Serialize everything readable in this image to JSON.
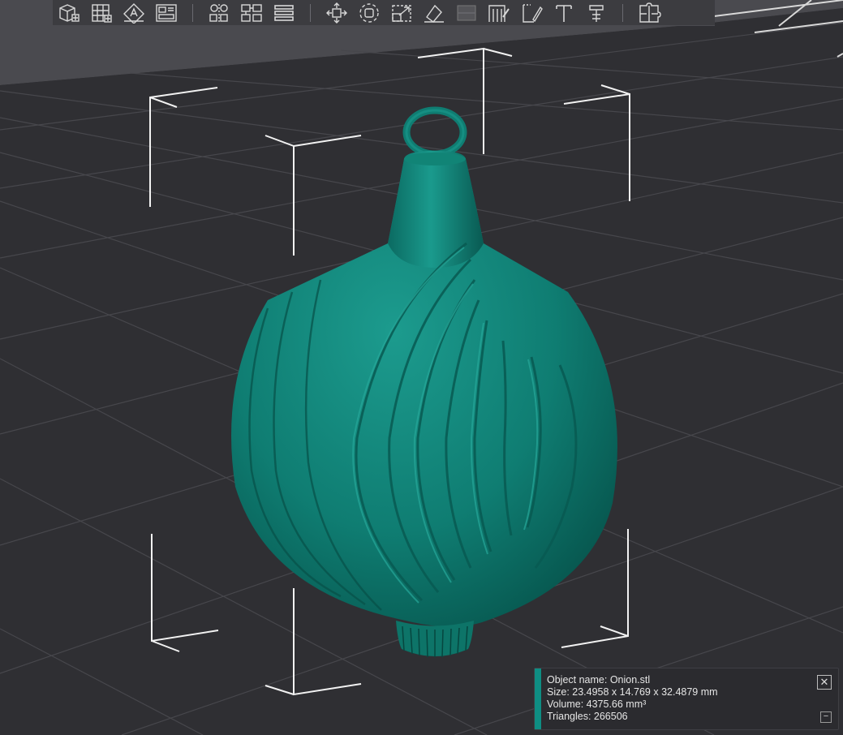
{
  "toolbar": {
    "groups": [
      [
        "add-object-icon",
        "arrange-grid-icon",
        "auto-orient-icon",
        "plate-layout-icon"
      ],
      [
        "split-objects-icon",
        "split-parts-icon",
        "layers-icon"
      ],
      [
        "move-icon",
        "rotate-icon",
        "scale-icon",
        "lay-on-face-icon",
        "cut-icon",
        "support-paint-icon",
        "seam-paint-icon",
        "text-emboss-icon",
        "measure-icon"
      ],
      [
        "assembly-icon"
      ]
    ]
  },
  "viewport": {
    "background_color": "#2f2f33",
    "model_color": "#0f7d72"
  },
  "object_info": {
    "name_line": "Object name: Onion.stl",
    "size_line": "Size: 23.4958 x 14.769 x 32.4879 mm",
    "volume_line": "Volume: 4375.66 mm³",
    "triangles_line": "Triangles: 266506",
    "close_symbol": "✕",
    "collapse_symbol": "−"
  }
}
